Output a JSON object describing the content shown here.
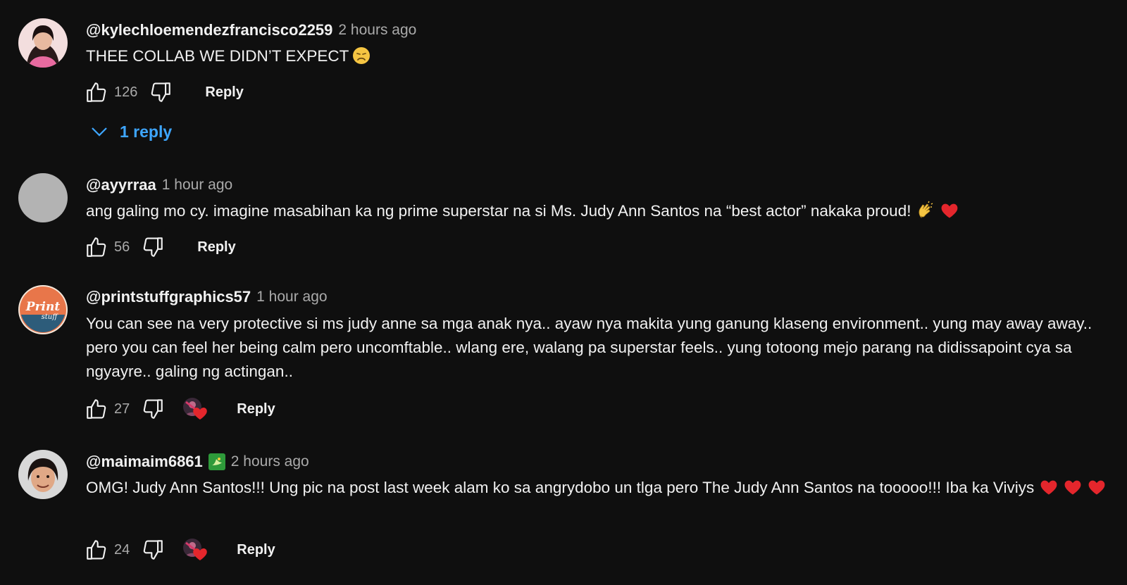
{
  "comments": [
    {
      "author": "@kylechloemendezfrancisco2259",
      "time": "2 hours ago",
      "text": "THEE COLLAB WE DIDN’T EXPECT",
      "emoji": "weary-face",
      "likes": "126",
      "reply_label": "Reply",
      "replies_label": "1 reply"
    },
    {
      "author": "@ayyrraa",
      "time": "1 hour ago",
      "text": "ang galing mo cy. imagine masabihan ka ng prime superstar na si Ms. Judy Ann Santos na “best actor” nakaka proud!",
      "emoji": "clapping-hands heart",
      "likes": "56",
      "reply_label": "Reply"
    },
    {
      "author": "@printstuffgraphics57",
      "time": "1 hour ago",
      "text": "You can see na very protective si ms judy anne sa mga anak nya.. ayaw nya makita yung ganung klaseng environment.. yung may away away.. pero you can feel her being calm pero uncomftable.. wlang ere, walang pa superstar feels.. yung totoong mejo parang na didissapoint cya sa ngyayre.. galing ng actingan..",
      "likes": "27",
      "reply_label": "Reply",
      "creator_heart": true
    },
    {
      "author": "@maimaim6861",
      "time": "2 hours ago",
      "text": "OMG! Judy Ann Santos!!! Ung pic na post last week alam ko sa angrydobo un tlga pero The Judy Ann Santos na tooooo!!! Iba ka Viviys",
      "emoji": "heart heart heart",
      "likes": "24",
      "reply_label": "Reply",
      "creator_heart": true,
      "member_badge": "member-badge-icon"
    }
  ],
  "colors": {
    "background": "#0f0f0f",
    "text": "#f1f1f1",
    "secondary": "#aaaaaa",
    "link": "#3ea6ff",
    "heart": "#e4262c"
  }
}
